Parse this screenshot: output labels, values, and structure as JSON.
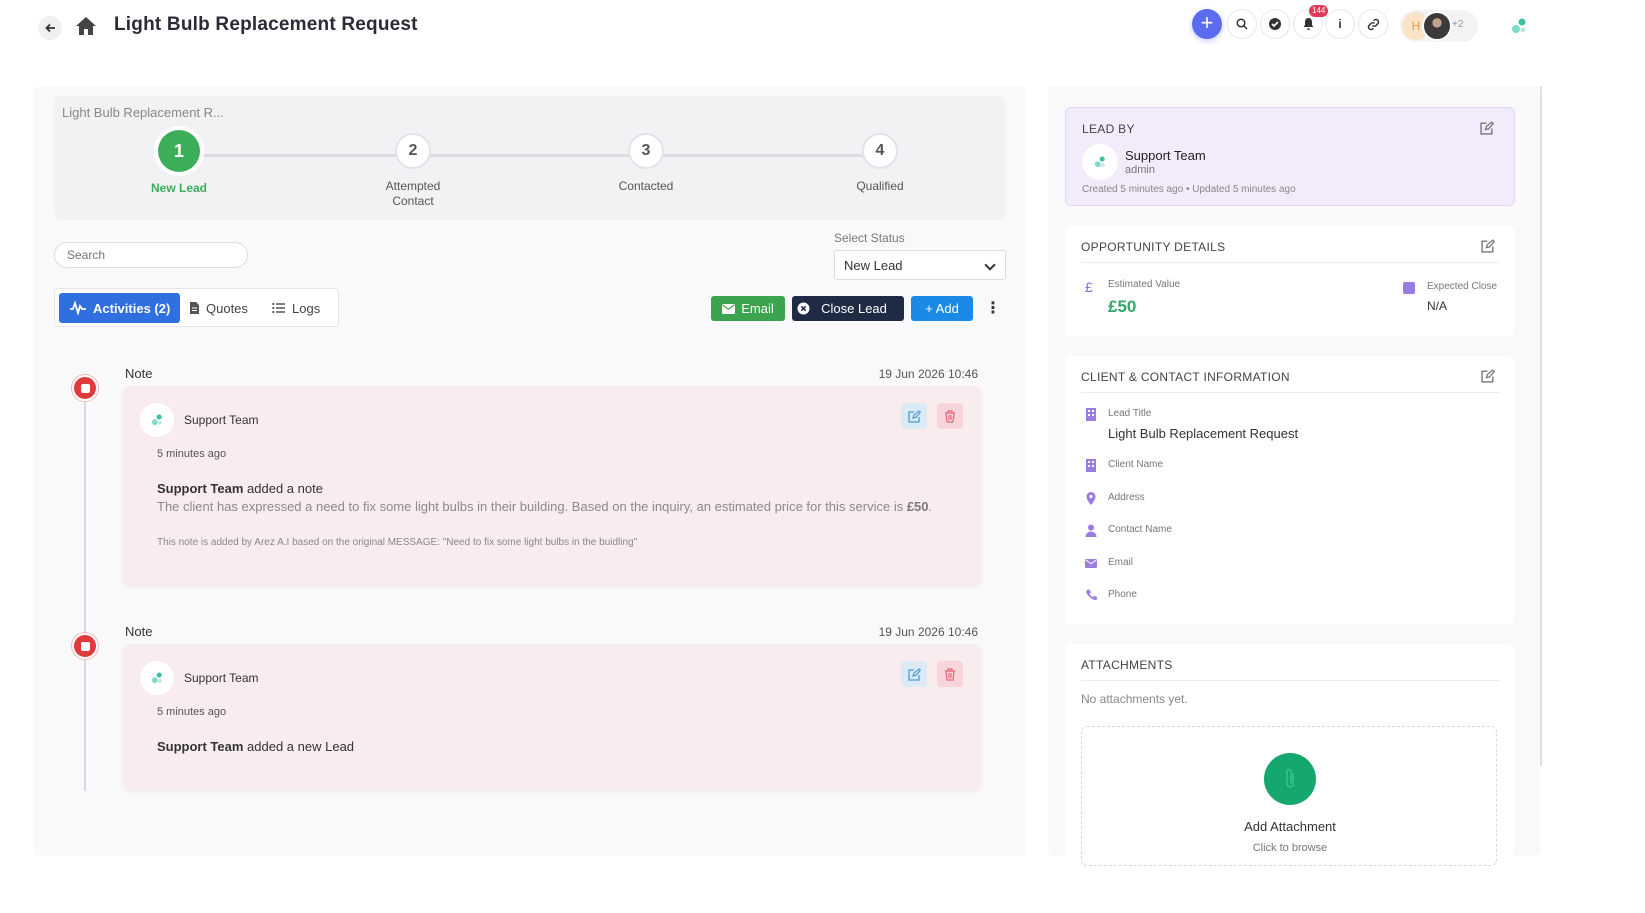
{
  "header": {
    "title": "Light Bulb Replacement Request",
    "notif_count": "144",
    "avatar_initial": "H",
    "avatar_more": "+2",
    "info_label": "i"
  },
  "stepper": {
    "title": "Light Bulb Replacement R...",
    "steps": [
      {
        "num": "1",
        "label": "New Lead"
      },
      {
        "num": "2",
        "label": "Attempted Contact"
      },
      {
        "num": "3",
        "label": "Contacted"
      },
      {
        "num": "4",
        "label": "Qualified"
      }
    ]
  },
  "search": {
    "placeholder": "Search"
  },
  "status": {
    "label": "Select Status",
    "selected": "New Lead"
  },
  "tabs": [
    {
      "label": "Activities (2)"
    },
    {
      "label": "Quotes"
    },
    {
      "label": "Logs"
    }
  ],
  "actions": {
    "email": "Email",
    "close_lead": "Close Lead",
    "add": "+ Add"
  },
  "notes": [
    {
      "type": "Note",
      "date": "19 Jun 2026 10:46",
      "author": "Support Team",
      "time": "5 minutes ago",
      "headline_author": "Support Team",
      "headline_action": " added a note",
      "body": "The client has expressed a need to fix some light bulbs in their building. Based on the inquiry, an estimated price for this service is ",
      "body_price": "£50",
      "footnote": "This note is added by Arez A.I based on the original MESSAGE: \"Need to fix some light bulbs in the buidling\""
    },
    {
      "type": "Note",
      "date": "19 Jun 2026 10:46",
      "author": "Support Team",
      "time": "5 minutes ago",
      "headline_author": "Support Team",
      "headline_action": " added a new Lead"
    }
  ],
  "lead_by": {
    "title": "LEAD BY",
    "name": "Support Team",
    "role": "admin",
    "meta": "Created 5 minutes ago  •  Updated 5 minutes ago"
  },
  "opportunity": {
    "title": "OPPORTUNITY DETAILS",
    "estimated_label": "Estimated Value",
    "estimated_value": "£50",
    "currency_symbol": "£",
    "close_label": "Expected Close",
    "close_value": "N/A"
  },
  "client": {
    "title": "CLIENT & CONTACT INFORMATION",
    "lead_title_label": "Lead Title",
    "lead_title_value": "Light Bulb Replacement Request",
    "client_name_label": "Client Name",
    "address_label": "Address",
    "contact_name_label": "Contact Name",
    "email_label": "Email",
    "phone_label": "Phone"
  },
  "attachments": {
    "title": "ATTACHMENTS",
    "empty": "No attachments yet.",
    "add_title": "Add Attachment",
    "add_sub": "Click to browse"
  },
  "colors": {
    "accent_green": "#3cae5a",
    "primary_blue": "#2f6fe0",
    "dark_navy": "#1f2a44",
    "note_bg": "#f9ecee",
    "danger_red": "#e03b3b"
  }
}
